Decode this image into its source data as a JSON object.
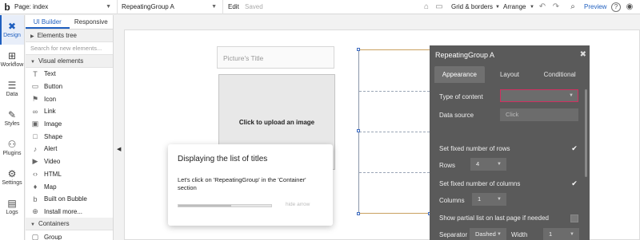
{
  "topbar": {
    "logo": "b",
    "page_select": "Page: index",
    "element_select": "RepeatingGroup A",
    "edit": "Edit",
    "saved": "Saved",
    "grid_borders": "Grid & borders",
    "arrange": "Arrange",
    "preview": "Preview",
    "help": "?"
  },
  "leftnav": [
    {
      "label": "Design",
      "icon": "design-icon"
    },
    {
      "label": "Workflow",
      "icon": "workflow-icon"
    },
    {
      "label": "Data",
      "icon": "data-icon"
    },
    {
      "label": "Styles",
      "icon": "styles-icon"
    },
    {
      "label": "Plugins",
      "icon": "plugins-icon"
    },
    {
      "label": "Settings",
      "icon": "settings-icon"
    },
    {
      "label": "Logs",
      "icon": "logs-icon"
    }
  ],
  "panel": {
    "tabs": [
      "UI Builder",
      "Responsive"
    ],
    "elements_tree": "Elements tree",
    "search_placeholder": "Search for new elements...",
    "visual_elements": "Visual elements",
    "items": [
      "Text",
      "Button",
      "Icon",
      "Link",
      "Image",
      "Shape",
      "Alert",
      "Video",
      "HTML",
      "Map",
      "Built on Bubble",
      "Install more..."
    ],
    "containers": "Containers",
    "group": "Group"
  },
  "canvas": {
    "picture_title": "Picture's Title",
    "upload_image": "Click to upload an image"
  },
  "tooltip": {
    "title": "Displaying the list of titles",
    "body": "Let's click on 'RepeatingGroup' in the 'Container' section",
    "hide": "hide arrow",
    "progress": 0.57
  },
  "properties": {
    "title": "RepeatingGroup A",
    "tabs": [
      "Appearance",
      "Layout",
      "Conditional"
    ],
    "type_of_content": "Type of content",
    "data_source": "Data source",
    "data_source_placeholder": "Click",
    "fixed_rows_label": "Set fixed number of rows",
    "rows_label": "Rows",
    "rows_value": "4",
    "fixed_columns_label": "Set fixed number of columns",
    "columns_label": "Columns",
    "columns_value": "1",
    "partial_list_label": "Show partial list on last page if needed",
    "separator_label": "Separator",
    "separator_value": "Dashed",
    "width_label": "Width",
    "width_value": "1"
  }
}
